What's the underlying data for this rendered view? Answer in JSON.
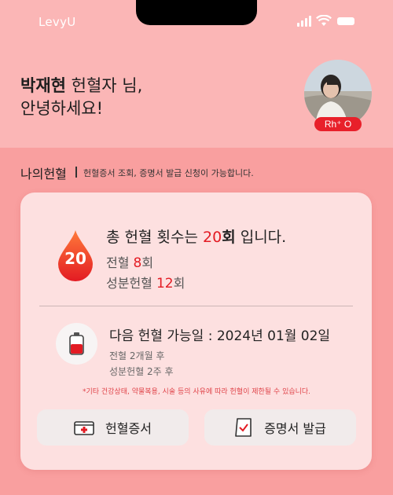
{
  "status_bar": {
    "carrier": "LevyU"
  },
  "greeting": {
    "name": "박재현",
    "rest_line1": " 헌혈자 님,",
    "line2": "안녕하세요!"
  },
  "profile": {
    "blood_type": "Rh⁺ O"
  },
  "section": {
    "title": "나의헌혈",
    "description": "헌혈증서 조회, 증명서 발급 신청이 가능합니다."
  },
  "summary": {
    "badge_count": "20",
    "total_prefix": "총 헌혈 횟수는 ",
    "total_count": "20",
    "total_unit": "회",
    "total_suffix": " 입니다.",
    "whole_blood_label": "전혈 ",
    "whole_blood_count": "8",
    "whole_blood_unit": "회",
    "apheresis_label": "성분헌혈 ",
    "apheresis_count": "12",
    "apheresis_unit": "회"
  },
  "next_donation": {
    "label": "다음 헌혈 가능일 : 2024년 01월 02일",
    "whole_blood_note": "전혈 2개월 후",
    "apheresis_note": "성분헌혈 2주 후"
  },
  "notice": "*기타 건강상태, 약물복용, 시술 등의 사유에 따라 헌혈이 제한될 수 있습니다.",
  "buttons": {
    "certificate": "헌혈증서",
    "issue": "증명서 발급"
  },
  "colors": {
    "accent": "#e31b23",
    "header_bg": "#fbb6b6",
    "body_bg": "#f99f9f",
    "card_bg": "#fde0e0"
  }
}
